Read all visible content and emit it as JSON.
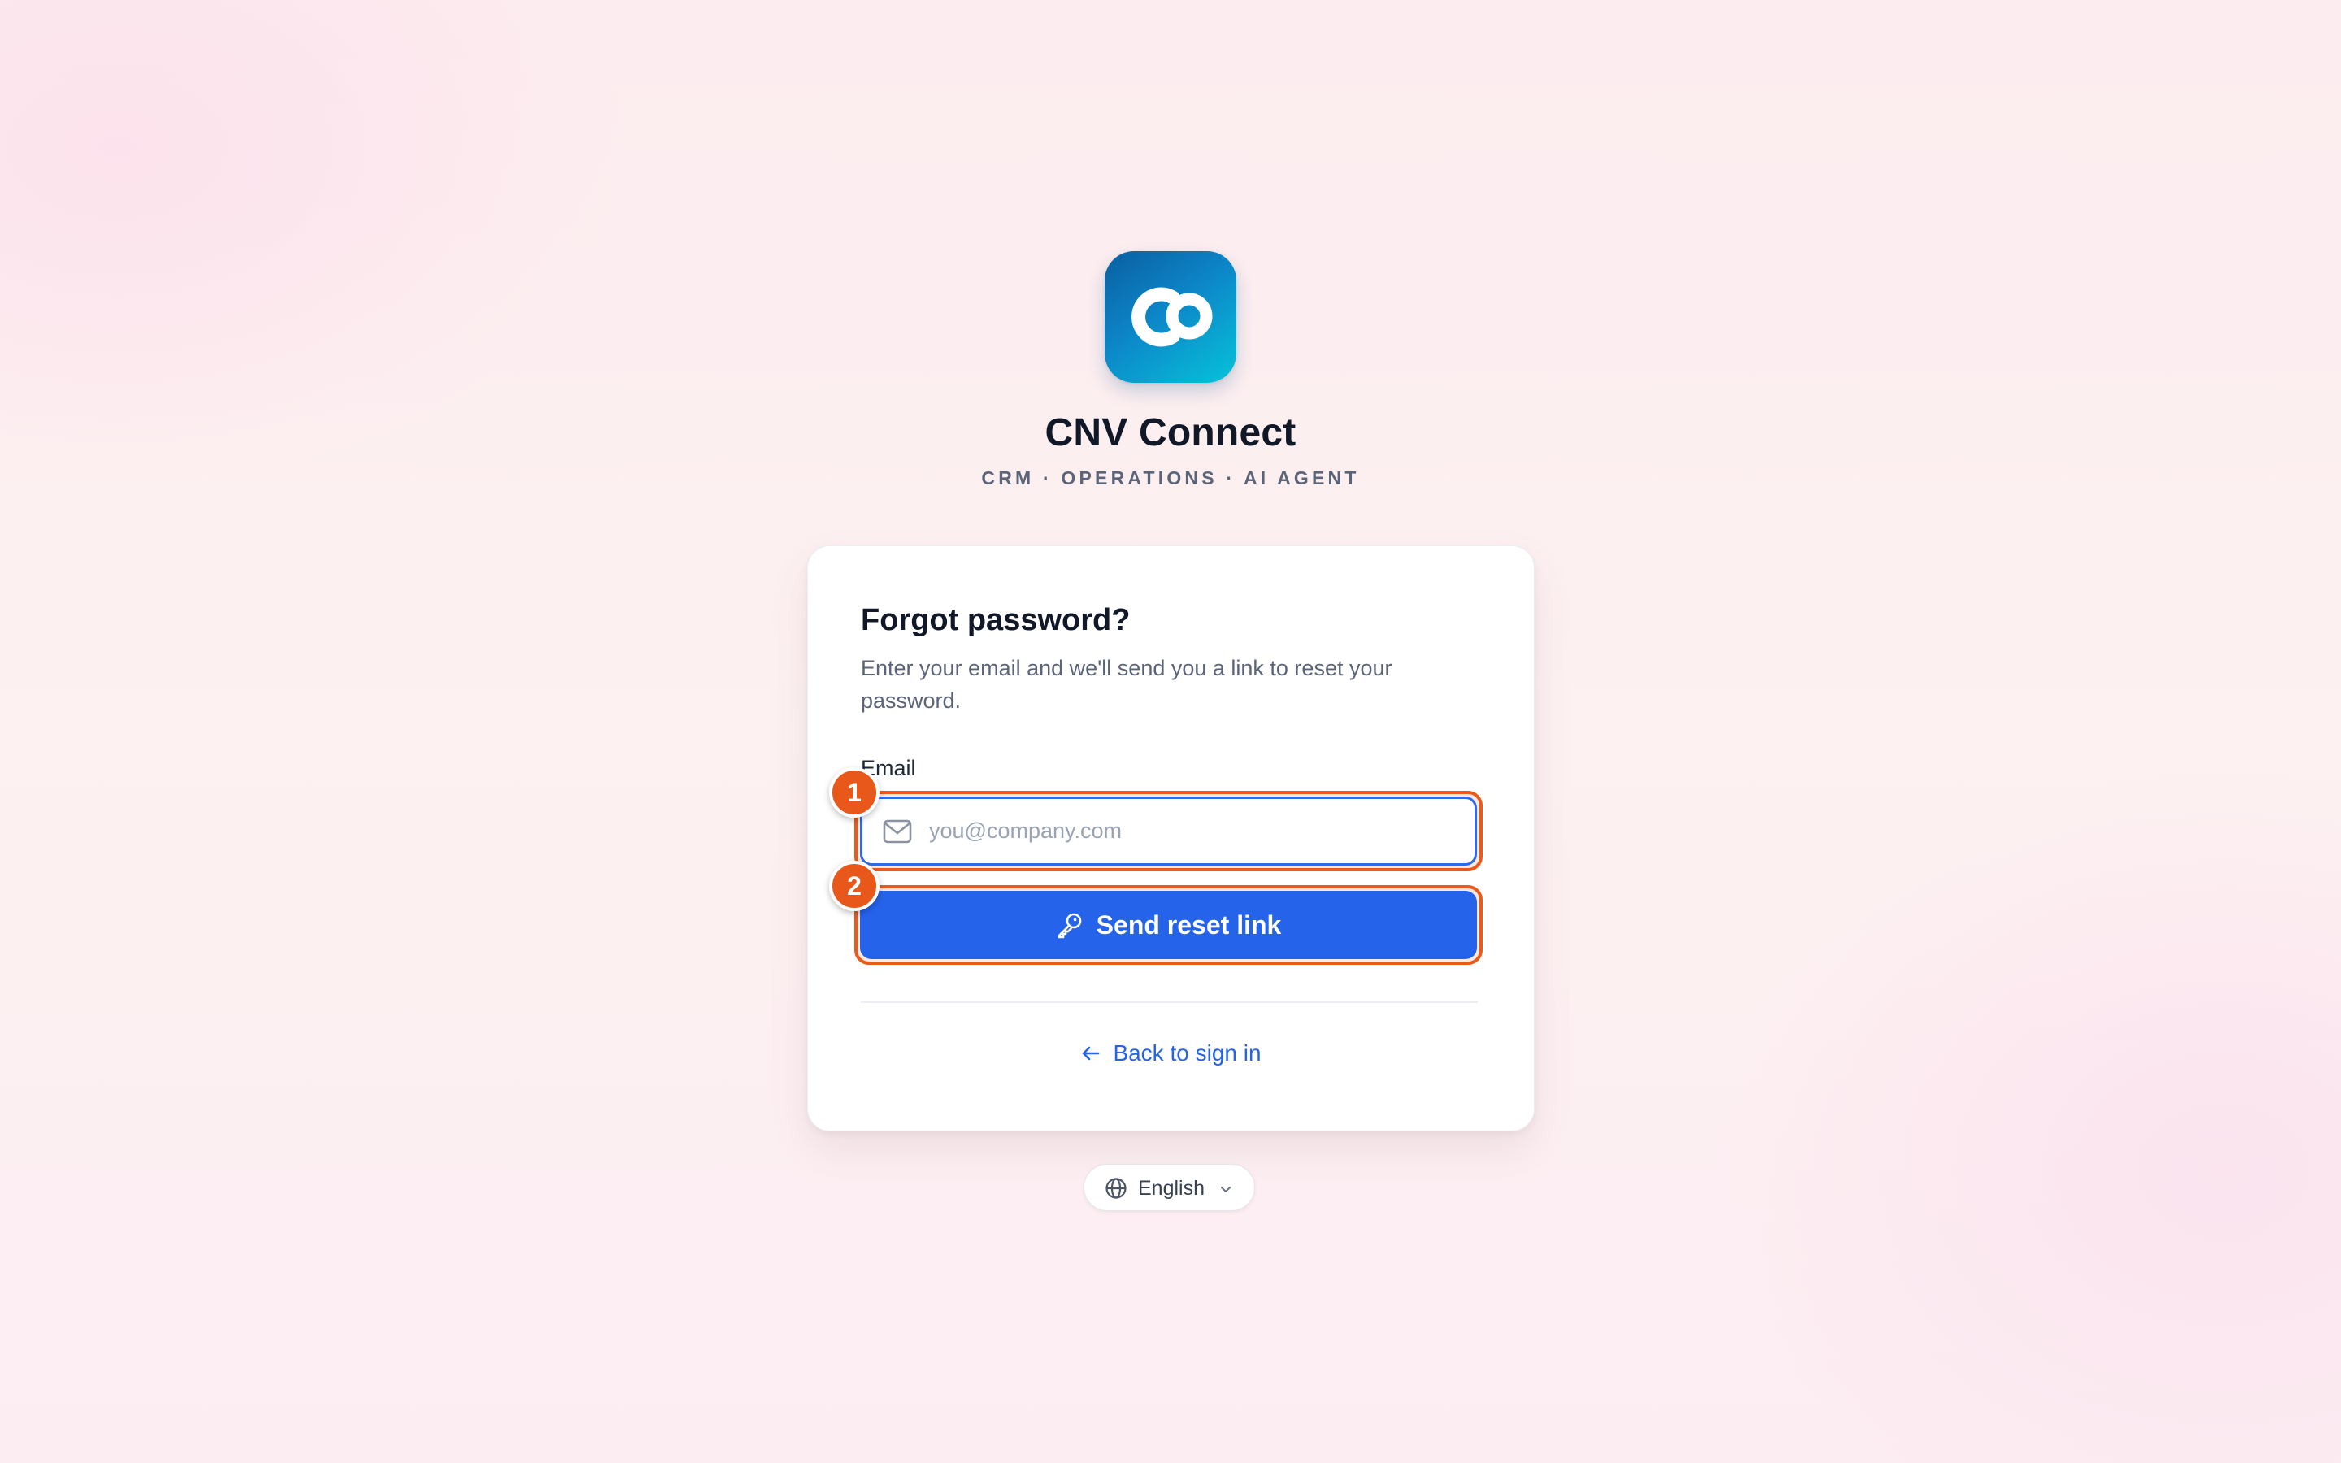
{
  "brand": {
    "logo_icon": "cnv-connect-logo-icon",
    "title": "CNV Connect",
    "subtitle": "CRM · OPERATIONS · AI AGENT",
    "colors": {
      "logo_gradient_start": "#0a5fa0",
      "logo_gradient_end": "#07c2da"
    }
  },
  "form": {
    "title": "Forgot password?",
    "description": "Enter your email and we'll send you a link to reset your password.",
    "email_label": "Email",
    "email_placeholder": "you@company.com",
    "email_value": "",
    "email_icon": "mail-icon",
    "submit_label": "Send reset link",
    "submit_icon": "key-icon",
    "back_label": "Back to sign in",
    "back_icon": "arrow-left-icon"
  },
  "annotations": {
    "marker_1": "1",
    "marker_2": "2",
    "marker_color": "#e8581a"
  },
  "language": {
    "icon": "globe-icon",
    "selected": "English",
    "dropdown_icon": "chevron-down-icon"
  },
  "colors": {
    "primary": "#2563eb",
    "text": "#111827",
    "muted": "#5b6478",
    "highlight": "#ea5a1a"
  }
}
